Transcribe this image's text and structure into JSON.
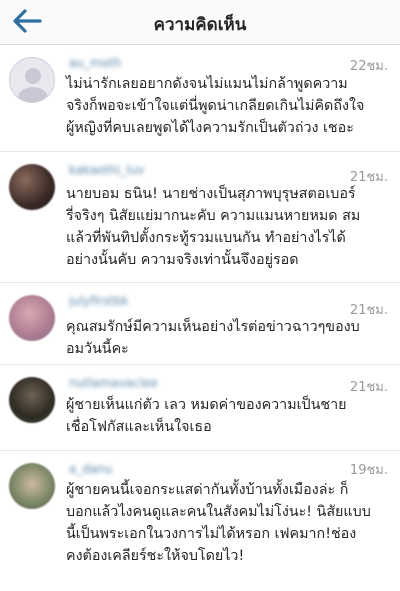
{
  "header": {
    "title": "ความคิดเห็น"
  },
  "comments": [
    {
      "username": "au_moth",
      "time": "22ชม.",
      "text": "ไม่น่ารักเลยอยากดังจนไม่แมนไม่กล้าพูดความ\nจริงก็พอจะเข้าใจแต่นี่พูดน่าเกลียดเกินไม่คิดถึงใจ\nผู้หญิงที่คบเลยพูดได้ไงความรักเป็นตัวถ่วง เชอะ"
    },
    {
      "username": "kakaothi_luv",
      "time": "21ชม.",
      "text": "นายบอม ธนิน! นายช่างเป็นสุภาพบุรุษสตอเบอร์\nรี่จริงๆ นิสัยแย่มากนะคับ ความแมนหายหมด สม\nแล้วที่พันทิปตั้งกระทู้รวมแบนกัน ทำอย่างไรได้\nอย่างนั้นคับ ความจริงเท่านั้นจึงอยู่รอด"
    },
    {
      "username": "julyfirstbk",
      "time": "21ชม.",
      "text": "คุณสมรักษ์มีความเห็นอย่างไรต่อข่าวฉาวๆของบ\nอมวันนี้คะ"
    },
    {
      "username": "nutlamavaclee",
      "time": "21ชม.",
      "text": "ผู้ชายเห็นแก่ตัว เลว หมดค่าของความเป็นชาย\nเชื่อโฟกัสและเห็นใจเธอ"
    },
    {
      "username": "a_danu",
      "time": "19ชม.",
      "text": "ผู้ชายคนนี้เจอกระแสด่ากันทั้งบ้านทั้งเมืองล่ะ ก็\nบอกแล้วไงคนดูและคนในสังคมไม่โง่นะ! นิสัยแบบ\nนี้เป็นพระเอกในวงการไม่ได้หรอก เฟคมาก!ช่อง\nคงต้องเคลียร์ชะให้จบโดยไว!"
    }
  ],
  "colors": {
    "accent": "#2f6f9f",
    "username": "#3f729b",
    "time": "#999999",
    "text": "#262626"
  },
  "icons": {
    "back": "arrow-left-icon"
  }
}
